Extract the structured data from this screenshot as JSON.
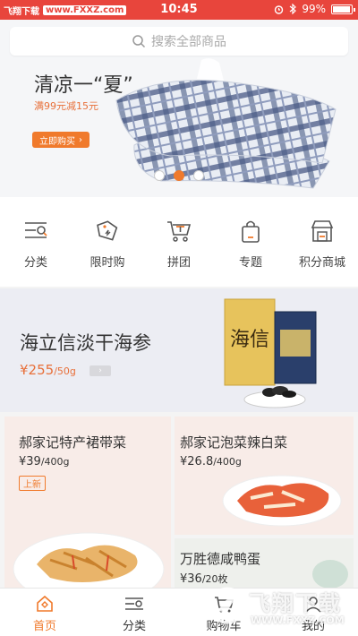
{
  "status_bar": {
    "watermark_left_a": "飞翔下载",
    "watermark_left_b": "www.FXXZ.com",
    "time": "10:45",
    "battery": "99%"
  },
  "search": {
    "placeholder": "搜索全部商品"
  },
  "banner": {
    "title": "清凉一“夏”",
    "subtitle": "满99元减15元",
    "button": "立即购买",
    "dots": 3,
    "active_dot": 2
  },
  "quick_nav": [
    {
      "label": "分类",
      "icon": "category-icon"
    },
    {
      "label": "限时购",
      "icon": "flash-sale-tag-icon"
    },
    {
      "label": "拼团",
      "icon": "group-buy-cart-icon"
    },
    {
      "label": "专题",
      "icon": "topic-bag-icon"
    },
    {
      "label": "积分商城",
      "icon": "points-store-icon"
    }
  ],
  "promo": {
    "title": "海立信淡干海参",
    "price": "¥255",
    "unit": "/50g",
    "box_text": "海信"
  },
  "products": [
    {
      "title": "郝家记特产裙带菜",
      "price": "¥39",
      "unit": "/400g",
      "tag": "上新"
    },
    {
      "title": "郝家记泡菜辣白菜",
      "price": "¥26.8",
      "unit": "/400g"
    },
    {
      "title": "万胜德咸鸭蛋",
      "price": "¥36",
      "unit": "/20枚"
    }
  ],
  "tab_bar": [
    {
      "label": "首页",
      "icon": "home-icon",
      "active": true
    },
    {
      "label": "分类",
      "icon": "category-icon",
      "active": false
    },
    {
      "label": "购物车",
      "icon": "cart-icon",
      "active": false
    },
    {
      "label": "我的",
      "icon": "profile-icon",
      "active": false
    }
  ],
  "watermark": {
    "text": "飞翔下载",
    "url": "WWW.FXXZ.COM"
  },
  "colors": {
    "accent": "#f07a2c",
    "status_bar": "#e8453c"
  }
}
